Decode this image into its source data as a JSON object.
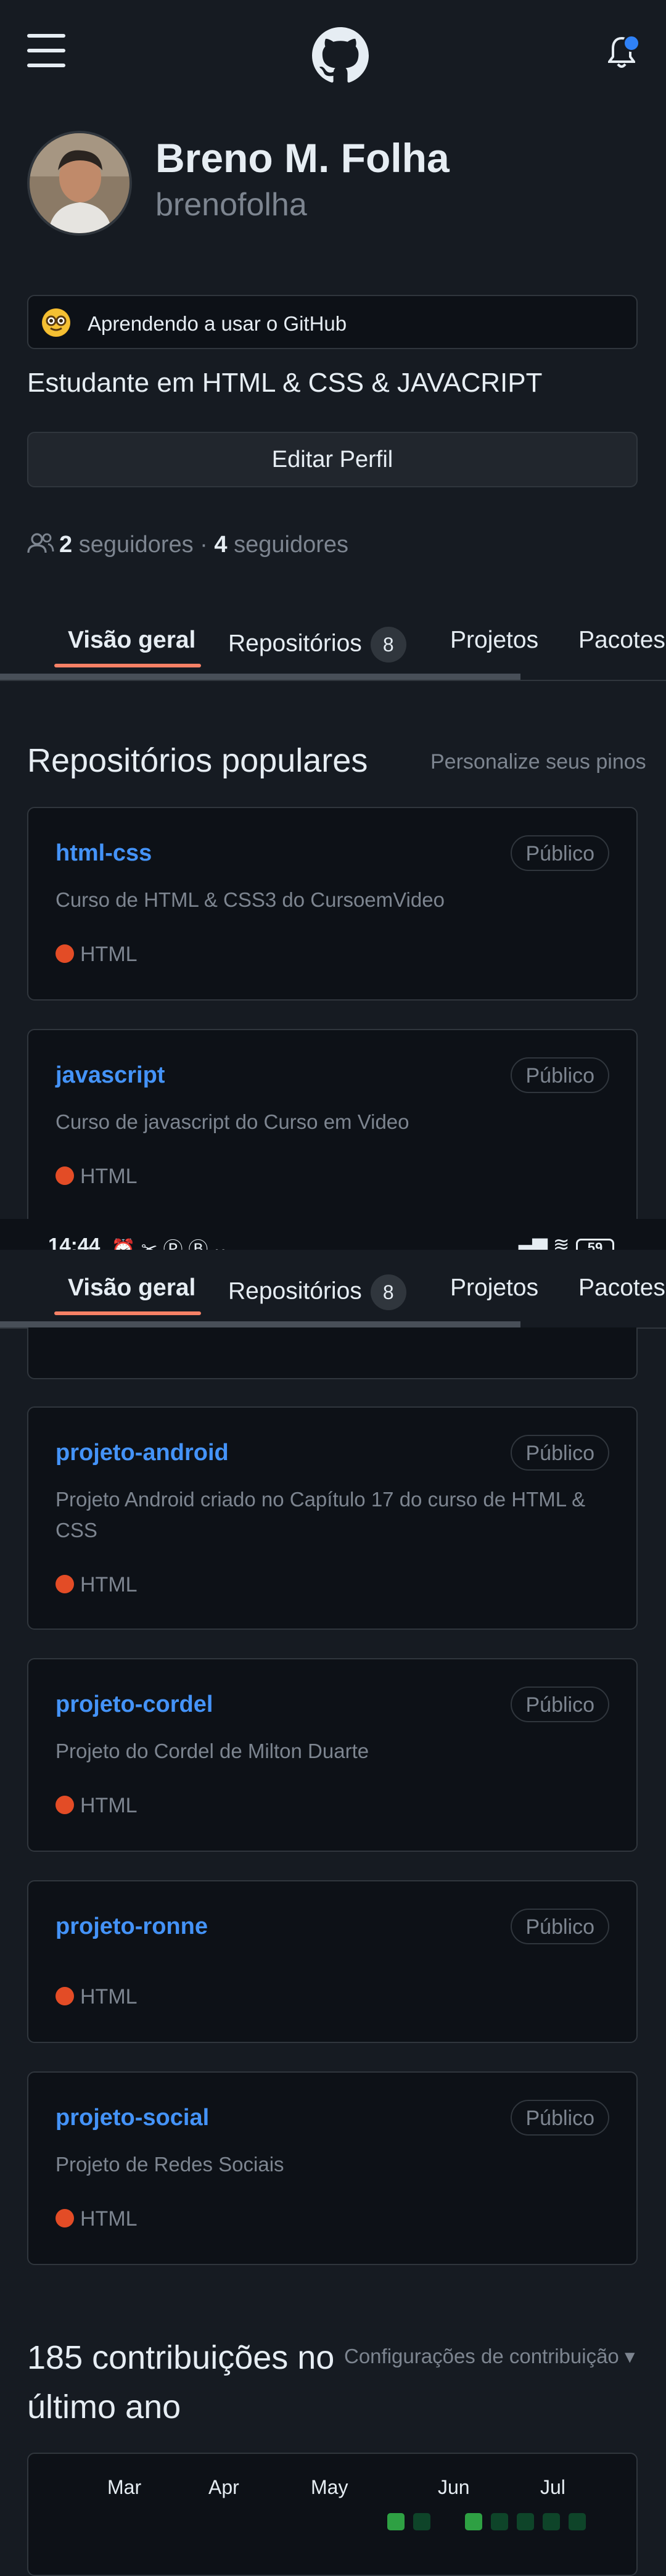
{
  "header": {
    "menu_icon": "menu-icon",
    "logo_icon": "github-logo-icon",
    "notification_icon": "bell-icon"
  },
  "profile": {
    "name": "Breno M. Folha",
    "login": "brenofolha",
    "status_text": "Aprendendo a usar o GitHub",
    "bio": "Estudante em HTML & CSS & JAVACRIPT",
    "edit_button": "Editar Perfil",
    "followers_count": "2",
    "followers_label": "seguidores",
    "separator": "·",
    "following_count": "4",
    "following_label": "seguidores"
  },
  "tabs": [
    {
      "label": "Visão geral",
      "active": true
    },
    {
      "label": "Repositórios",
      "count": "8"
    },
    {
      "label": "Projetos"
    },
    {
      "label": "Pacotes"
    }
  ],
  "popular": {
    "title": "Repositórios populares",
    "customize_link": "Personalize seus pinos",
    "repos": [
      {
        "name": "html-css",
        "visibility": "Público",
        "description": "Curso de HTML & CSS3 do CursoemVideo",
        "language": "HTML"
      },
      {
        "name": "javascript",
        "visibility": "Público",
        "description": "Curso de javascript do Curso em Video",
        "language": "HTML"
      },
      {
        "name": "projeto-android",
        "visibility": "Público",
        "description": "Projeto Android criado no Capítulo 17 do curso de HTML & CSS",
        "language": "HTML"
      },
      {
        "name": "projeto-cordel",
        "visibility": "Público",
        "description": "Projeto do Cordel de Milton Duarte",
        "language": "HTML"
      },
      {
        "name": "projeto-ronne",
        "visibility": "Público",
        "description": "",
        "language": "HTML"
      },
      {
        "name": "projeto-social",
        "visibility": "Público",
        "description": "Projeto de Redes Sociais",
        "language": "HTML"
      }
    ]
  },
  "system_bar": {
    "time": "14:44",
    "battery": "59"
  },
  "contributions": {
    "title": "185 contribuições no último ano",
    "settings_link": "Configurações de contribuição ▾",
    "months": [
      "Mar",
      "Apr",
      "May",
      "Jun",
      "Jul"
    ]
  },
  "colors": {
    "link": "#4493f8",
    "html_language": "#e34c26",
    "tab_underline": "#f78166",
    "contrib_high": "#2ea043",
    "contrib_low": "#0e4429"
  }
}
